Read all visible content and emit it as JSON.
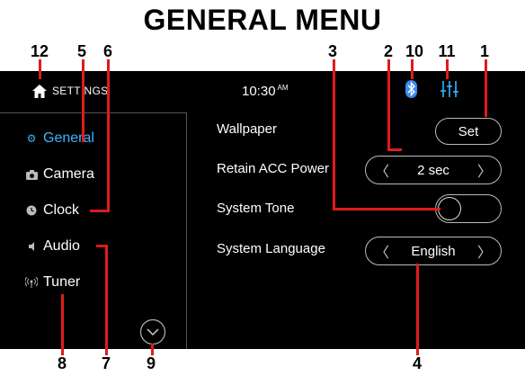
{
  "figure_title": "GENERAL MENU",
  "callouts": [
    "12",
    "5",
    "6",
    "3",
    "2",
    "10",
    "11",
    "1",
    "4",
    "8",
    "7",
    "9"
  ],
  "status_bar": {
    "home_label": "SETTINGS",
    "time": "10:30",
    "time_suffix": "AM",
    "icons": [
      "home-icon",
      "bluetooth-icon",
      "equalizer-icon"
    ]
  },
  "sidebar": {
    "items": [
      {
        "label": "General",
        "icon": "gear-icon",
        "active": true
      },
      {
        "label": "Camera",
        "icon": "camera-icon",
        "active": false
      },
      {
        "label": "Clock",
        "icon": "clock-icon",
        "active": false
      },
      {
        "label": "Audio",
        "icon": "speaker-icon",
        "active": false
      },
      {
        "label": "Tuner",
        "icon": "antenna-icon",
        "active": false
      }
    ],
    "scroll_down_icon": "chevron-down-circle-icon"
  },
  "settings": {
    "wallpaper": {
      "label": "Wallpaper",
      "button": "Set"
    },
    "retain_acc": {
      "label": "Retain ACC Power",
      "value": "2 sec"
    },
    "system_tone": {
      "label": "System Tone",
      "state": "off"
    },
    "language": {
      "label": "System Language",
      "value": "English"
    }
  },
  "colors": {
    "accent": "#3ab4ff",
    "callout_line": "#e01b1b",
    "screen_bg": "#000000"
  }
}
